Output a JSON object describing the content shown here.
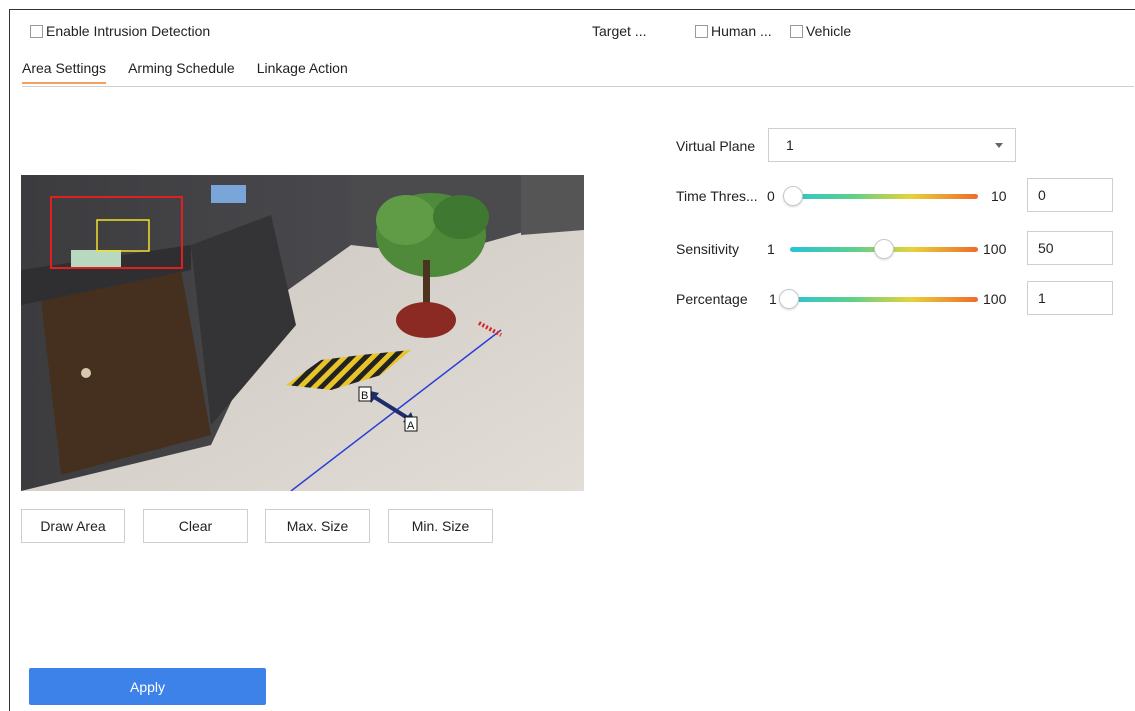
{
  "header": {
    "enable_label": "Enable Intrusion Detection",
    "enable_checked": false,
    "target_label": "Target ...",
    "human_label": "Human ...",
    "human_checked": false,
    "vehicle_label": "Vehicle",
    "vehicle_checked": false
  },
  "tabs": [
    {
      "label": "Area Settings",
      "active": true
    },
    {
      "label": "Arming Schedule",
      "active": false
    },
    {
      "label": "Linkage Action",
      "active": false
    }
  ],
  "video": {
    "marker_b": "B",
    "marker_a": "A",
    "colors": {
      "region_box": "#e02020",
      "target_box": "#f3e12a",
      "line": "#2a3fd8"
    }
  },
  "buttons": {
    "draw_area": "Draw Area",
    "clear": "Clear",
    "max_size": "Max. Size",
    "min_size": "Min. Size",
    "apply": "Apply"
  },
  "settings": {
    "virtual_plane": {
      "label": "Virtual Plane",
      "value": "1"
    },
    "time_threshold": {
      "label": "Time Thres...",
      "min": "0",
      "max": "10",
      "value": "0",
      "fraction": 0.0
    },
    "sensitivity": {
      "label": "Sensitivity",
      "min": "1",
      "max": "100",
      "value": "50",
      "fraction": 0.5
    },
    "percentage": {
      "label": "Percentage",
      "min": "1",
      "max": "100",
      "value": "1",
      "fraction": 0.0
    }
  },
  "colors": {
    "accent": "#3c82e8",
    "tab_underline": "#f0a060"
  }
}
